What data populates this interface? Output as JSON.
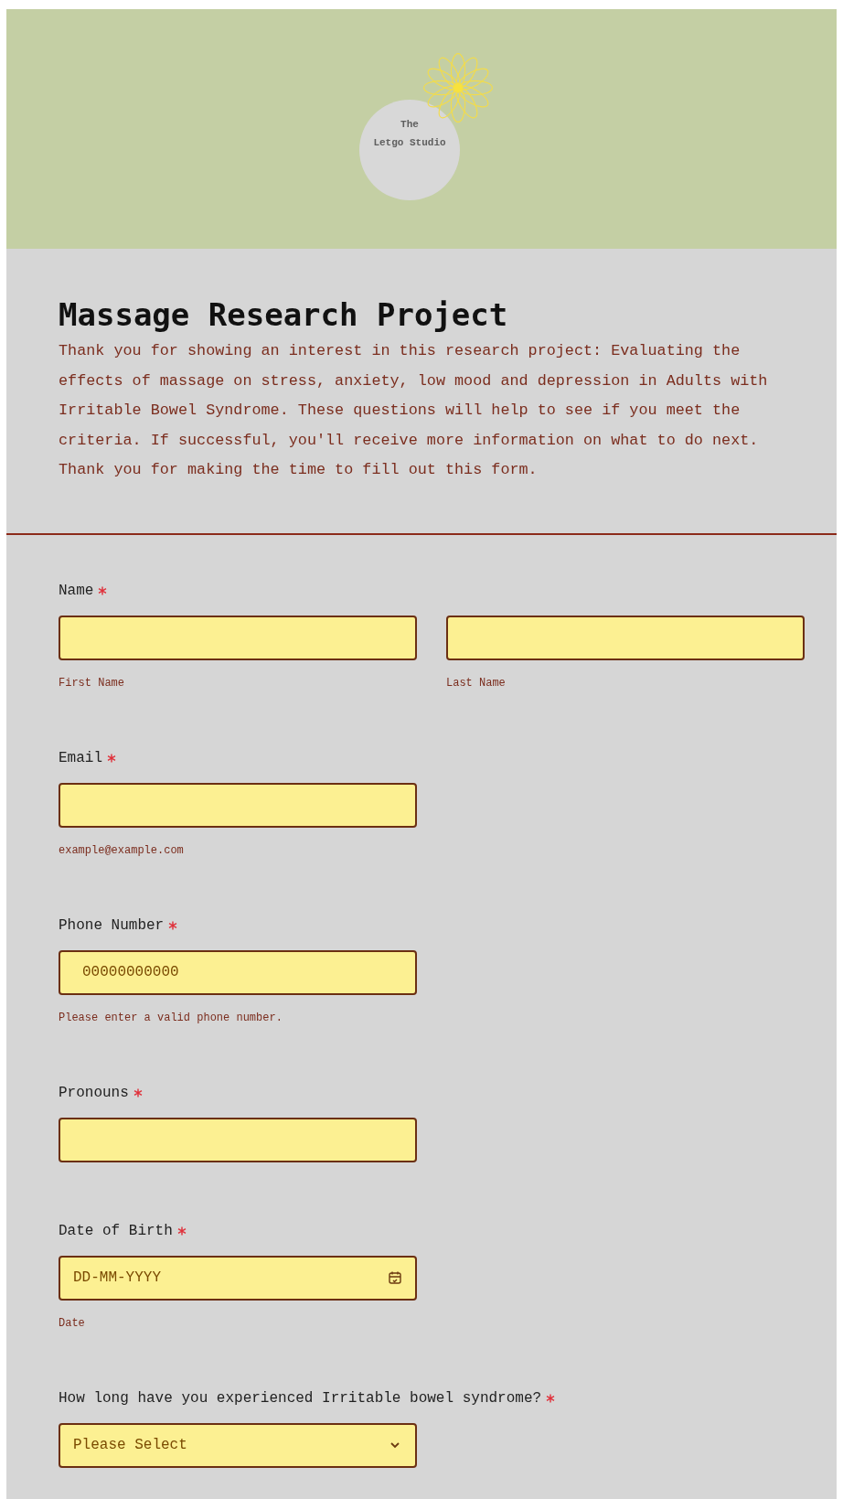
{
  "header": {
    "logo_text": [
      "The",
      "Letgo Studio"
    ]
  },
  "title": "Massage Research Project",
  "description": "Thank you for showing an interest in this research project: Evaluating the effects of massage on stress, anxiety, low mood and depression in Adults with Irritable Bowel Syndrome. These questions will help to see if you meet the criteria. If successful, you'll receive more information on what to do next. Thank you for making the time to fill out this form.",
  "fields": [
    {
      "kind": "pair",
      "label": "Name",
      "required": true,
      "subfields": [
        {
          "sublabel": "First Name"
        },
        {
          "sublabel": "Last Name"
        }
      ]
    },
    {
      "kind": "text",
      "label": "Email",
      "required": true,
      "sublabel": "example@example.com"
    },
    {
      "kind": "text",
      "label": "Phone Number",
      "required": true,
      "placeholder": "00000000000",
      "sublabel": "Please enter a valid phone number."
    },
    {
      "kind": "text",
      "label": "Pronouns",
      "required": true
    },
    {
      "kind": "date",
      "label": "Date of Birth",
      "required": true,
      "placeholder": "DD-MM-YYYY",
      "sublabel": "Date"
    },
    {
      "kind": "select",
      "label": "How long have you experienced Irritable bowel syndrome?",
      "required": true,
      "value": "Please Select"
    }
  ]
}
